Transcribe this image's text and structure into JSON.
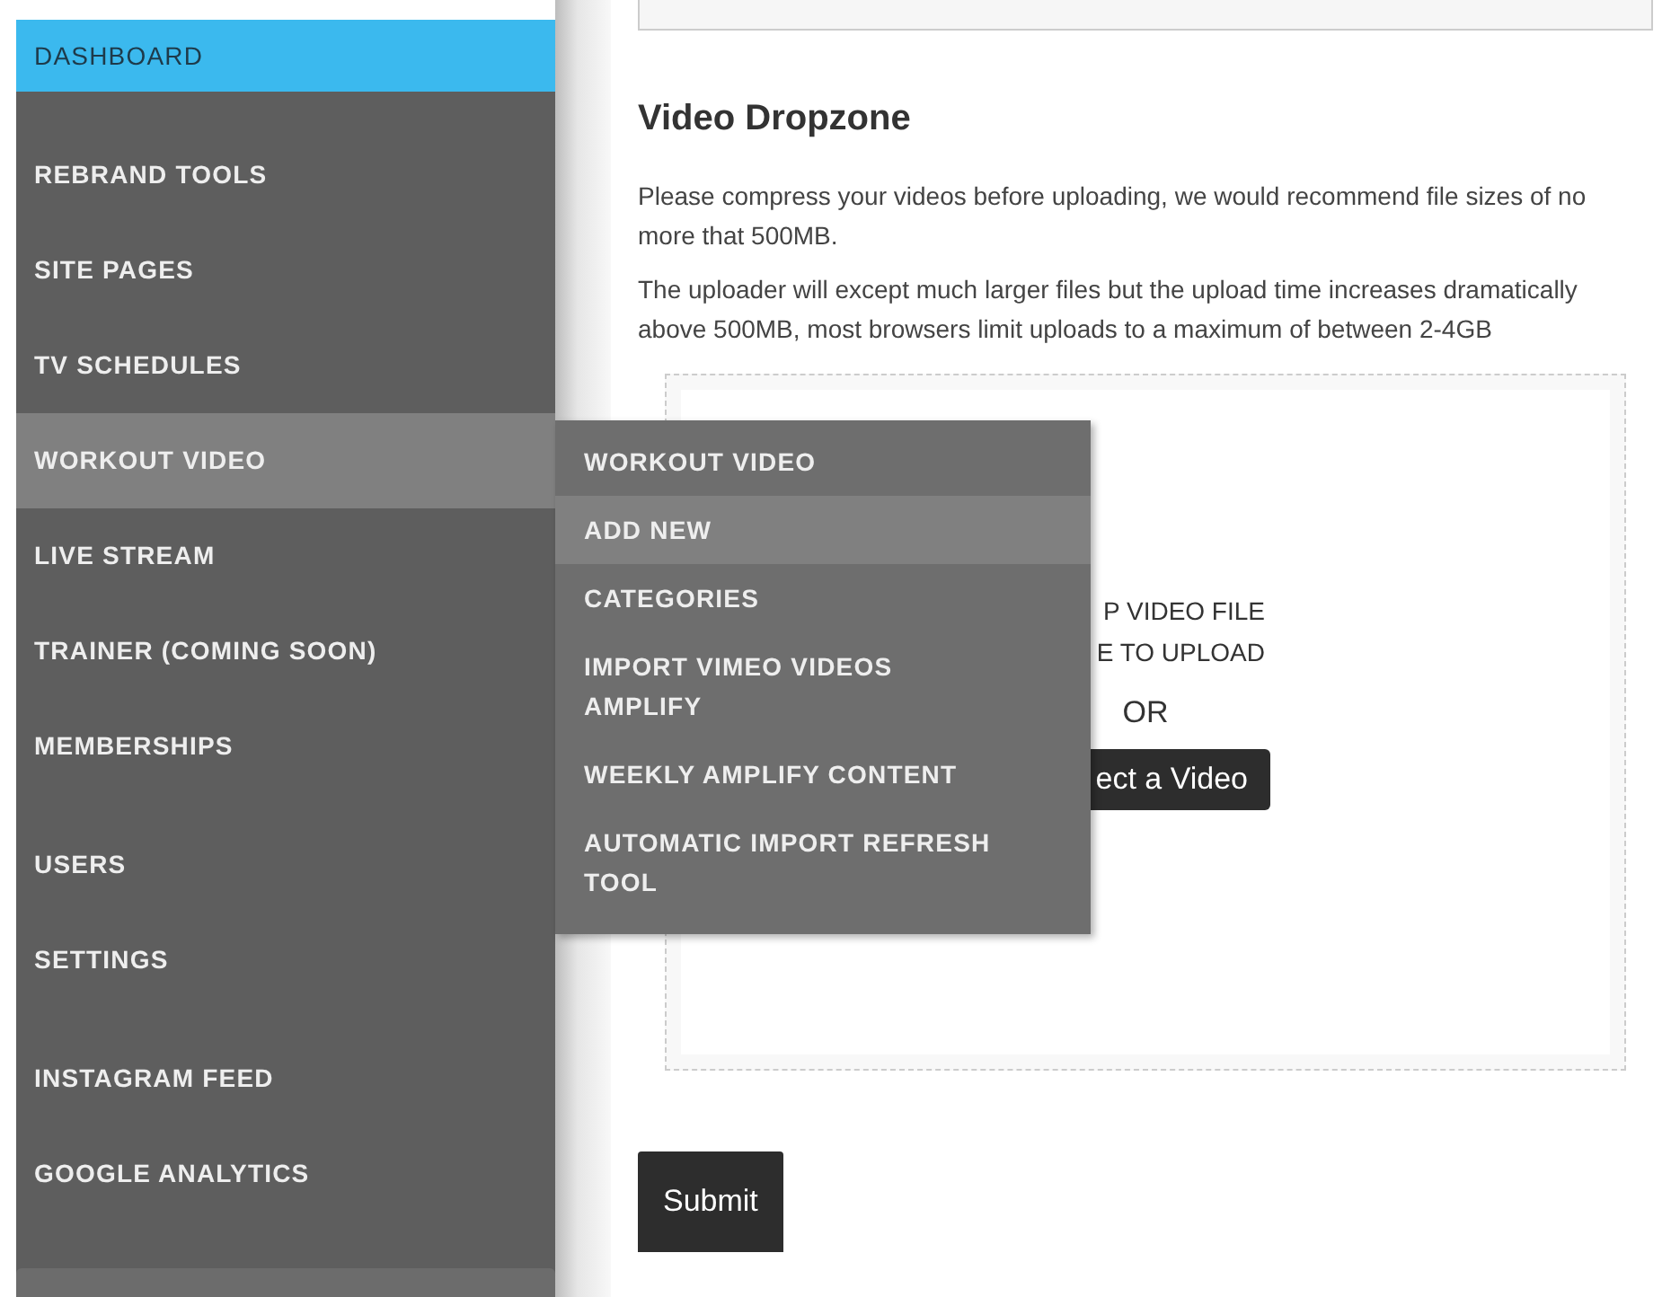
{
  "sidebar": {
    "groups": [
      [
        {
          "label": "DASHBOARD",
          "selected": true,
          "expanded": false
        },
        {
          "label": "REBRAND TOOLS",
          "selected": false,
          "expanded": false
        },
        {
          "label": "SITE PAGES",
          "selected": false,
          "expanded": false
        },
        {
          "label": "TV SCHEDULES",
          "selected": false,
          "expanded": false
        },
        {
          "label": "WORKOUT VIDEO",
          "selected": false,
          "expanded": true
        },
        {
          "label": "LIVE STREAM",
          "selected": false,
          "expanded": false
        },
        {
          "label": "TRAINER (COMING SOON)",
          "selected": false,
          "expanded": false
        },
        {
          "label": "MEMBERSHIPS",
          "selected": false,
          "expanded": false
        }
      ],
      [
        {
          "label": "USERS",
          "selected": false,
          "expanded": false
        },
        {
          "label": "SETTINGS",
          "selected": false,
          "expanded": false
        }
      ],
      [
        {
          "label": "INSTAGRAM FEED",
          "selected": false,
          "expanded": false
        },
        {
          "label": "GOOGLE ANALYTICS",
          "selected": false,
          "expanded": false
        }
      ]
    ]
  },
  "submenu": {
    "items": [
      {
        "label": "WORKOUT VIDEO",
        "selected": false
      },
      {
        "label": "ADD NEW",
        "selected": true
      },
      {
        "label": "CATEGORIES",
        "selected": false
      },
      {
        "label": "IMPORT VIMEO VIDEOS AMPLIFY",
        "selected": false
      },
      {
        "label": "WEEKLY AMPLIFY CONTENT",
        "selected": false
      },
      {
        "label": "AUTOMATIC IMPORT REFRESH TOOL",
        "selected": false
      }
    ]
  },
  "main": {
    "heading": "Video Dropzone",
    "paragraphs": [
      "Please compress your videos before uploading, we would recommend file sizes of no more that 500MB.",
      "The uploader will except much larger files but the upload time increases dramatically above 500MB, most browsers limit uploads to a maximum of between 2-4GB"
    ],
    "dropzone": {
      "lines": [
        "P VIDEO FILE",
        "E TO UPLOAD"
      ],
      "separator": "OR",
      "button": "ect a Video"
    },
    "submit": "Submit"
  }
}
